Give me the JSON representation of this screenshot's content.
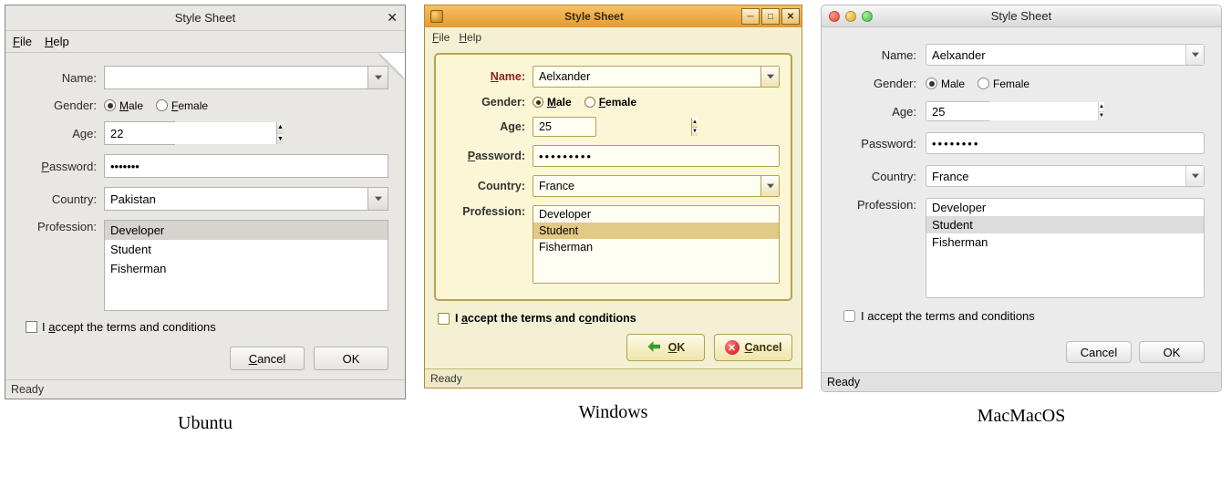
{
  "common": {
    "title": "Style Sheet",
    "menu": {
      "file": "File",
      "help": "Help"
    },
    "labels": {
      "name": "Name:",
      "gender": "Gender:",
      "age": "Age:",
      "password": "Password:",
      "country": "Country:",
      "profession": "Profession:"
    },
    "gender": {
      "male": "Male",
      "female": "Female"
    },
    "terms": "I accept the terms and conditions",
    "buttons": {
      "ok": "OK",
      "cancel": "Cancel"
    },
    "status": "Ready",
    "professions": [
      "Developer",
      "Student",
      "Fisherman"
    ]
  },
  "ubuntu": {
    "caption": "Ubuntu",
    "name": "",
    "age": "22",
    "password": "•••••••",
    "country": "Pakistan",
    "gender_selected": "male",
    "profession_selected": "Developer",
    "underlined": {
      "file": "F",
      "file_rest": "ile",
      "help": "H",
      "help_rest": "elp",
      "male": "M",
      "male_rest": "ale",
      "female": "F",
      "female_rest": "emale",
      "password": "P",
      "password_rest": "assword:",
      "cancel": "C",
      "cancel_rest": "ancel",
      "accept_pre": "I ",
      "accept_u": "a",
      "accept_rest": "ccept the terms and conditions"
    }
  },
  "windows": {
    "caption": "Windows",
    "name": "Aelxander",
    "age": "25",
    "password": "•••••••••",
    "country": "France",
    "gender_selected": "male",
    "profession_selected": "Student",
    "name_label_u": "N",
    "name_label_rest": "ame:",
    "male_u": "M",
    "male_rest": "ale",
    "female_u": "F",
    "female_rest": "emale",
    "password_u": "P",
    "password_rest": "assword:",
    "ok_u": "O",
    "ok_rest": "K",
    "cancel_u": "C",
    "cancel_rest": "ancel",
    "terms_pre": "I ",
    "terms_u": "a",
    "terms_mid": "ccept the terms and c",
    "terms_u2": "o",
    "terms_rest": "nditions",
    "file_u": "F",
    "file_rest": "ile",
    "help_u": "H",
    "help_rest": "elp"
  },
  "mac": {
    "caption": "MacMacOS",
    "name": "Aelxander",
    "age": "25",
    "password": "••••••••",
    "country": "France",
    "gender_selected": "male",
    "profession_selected": "Student"
  }
}
